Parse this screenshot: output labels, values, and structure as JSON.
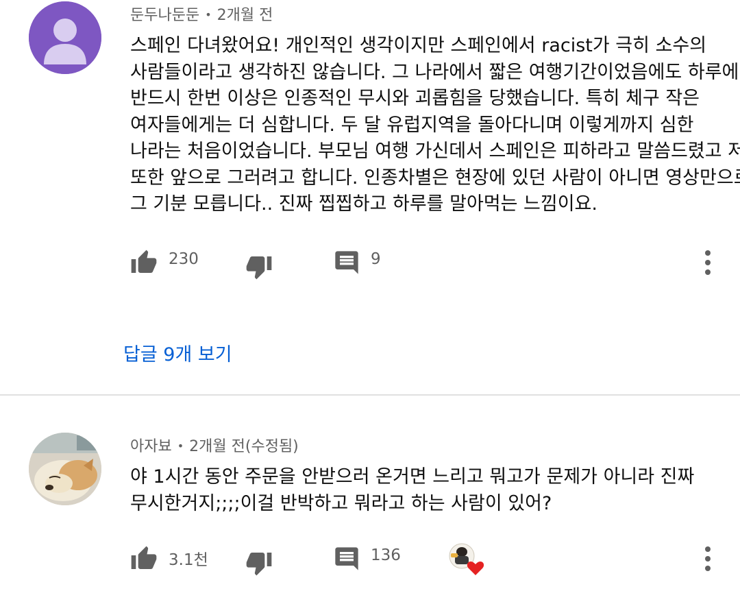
{
  "comments": [
    {
      "author": "둔두나둔둔",
      "time": "2개월 전",
      "lines": [
        "스페인 다녀왔어요! 개인적인 생각이지만 스페인에서 racist가 극히 소수의",
        "사람들이라고 생각하진 않습니다. 그 나라에서 짧은 여행기간이었음에도 하루에",
        "반드시 한번 이상은 인종적인 무시와 괴롭힘을 당했습니다. 특히 체구 작은",
        "여자들에게는 더 심합니다. 두 달 유럽지역을 돌아다니며 이렇게까지 심한",
        "나라는 처음이었습니다. 부모님 여행 가신데서 스페인은 피하라고 말씀드렸고 저",
        "또한 앞으로 그러려고 합니다. 인종차별은 현장에 있던 사람이 아니면 영상만으로",
        "그 기분 모릅니다.. 진짜 찝찝하고 하루를 말아먹는 느낌이요."
      ],
      "likes": "230",
      "replies": "9",
      "view_replies_label": "답글 9개 보기",
      "avatar_color": "#7e57c2"
    },
    {
      "author": "아자뵤",
      "time": "2개월 전(수정됨)",
      "lines": [
        "야 1시간 동안 주문을 안받으러 온거면 느리고 뭐고가 문제가 아니라 진짜",
        "무시한거지;;;;이걸 반박하고 뭐라고 하는 사람이 있어?"
      ],
      "likes": "3.1천",
      "replies": "136",
      "creator_heart": true
    }
  ],
  "colors": {
    "link": "#065fd4",
    "meta": "#606060",
    "heart": "#e52222",
    "icon": "#606060"
  },
  "icons": [
    "thumbs-up-icon",
    "thumbs-down-icon",
    "reply-comment-icon",
    "more-vert-icon",
    "creator-heart-icon"
  ]
}
